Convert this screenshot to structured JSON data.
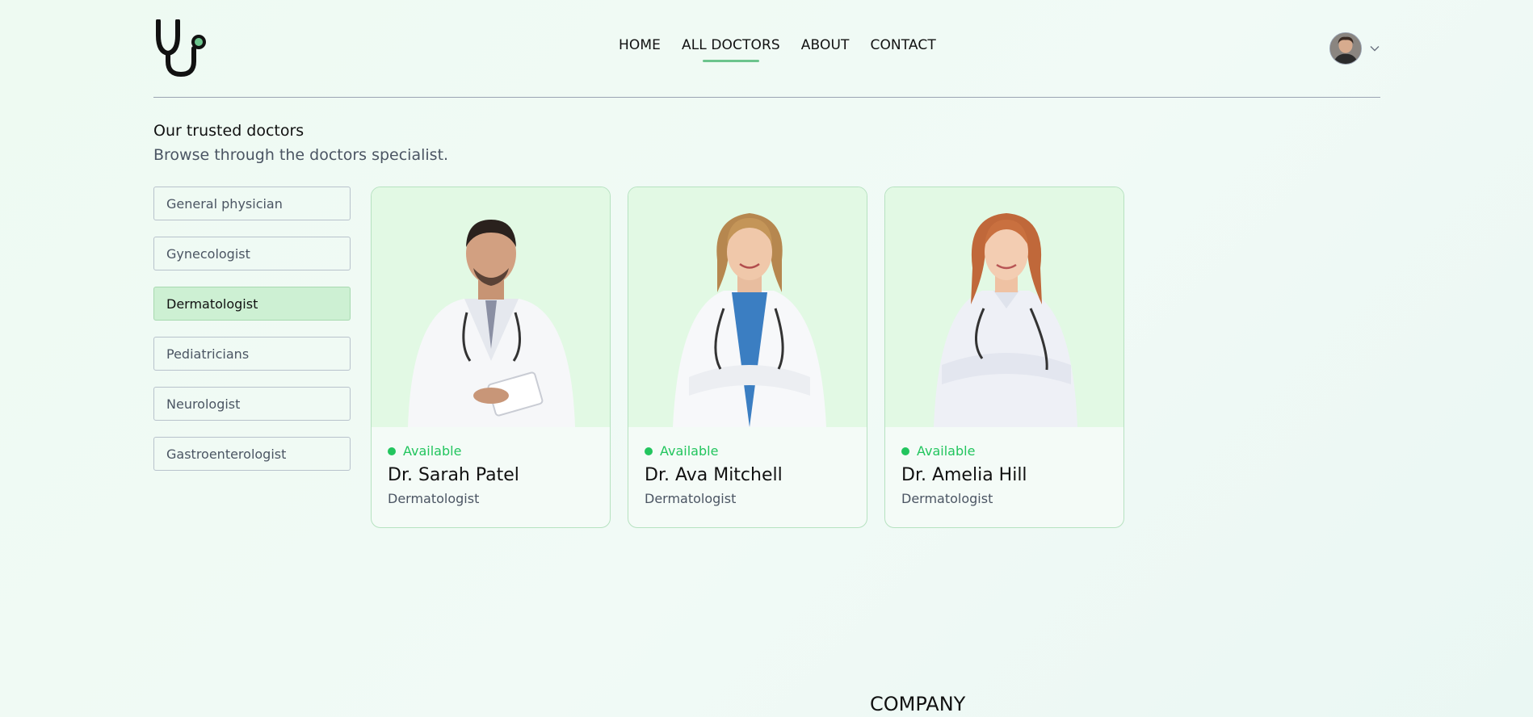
{
  "colors": {
    "accent": "#22c55e",
    "nav_underline": "#6cc48d",
    "selected_filter": "#cdf0d3",
    "card_image_bg": "#e2f9e4"
  },
  "header": {
    "logo_icon": "stethoscope-icon",
    "nav": [
      "HOME",
      "ALL DOCTORS",
      "ABOUT",
      "CONTACT"
    ],
    "active_nav": "ALL DOCTORS",
    "profile_menu_icon": "chevron-down-icon"
  },
  "intro": {
    "title": "Our trusted doctors",
    "subtitle": "Browse through the doctors specialist."
  },
  "filters": {
    "items": [
      "General physician",
      "Gynecologist",
      "Dermatologist",
      "Pediatricians",
      "Neurologist",
      "Gastroenterologist"
    ],
    "selected": "Dermatologist"
  },
  "doctors": [
    {
      "status": "Available",
      "name": "Dr. Sarah Patel",
      "speciality": "Dermatologist"
    },
    {
      "status": "Available",
      "name": "Dr. Ava Mitchell",
      "speciality": "Dermatologist"
    },
    {
      "status": "Available",
      "name": "Dr. Amelia Hill",
      "speciality": "Dermatologist"
    }
  ],
  "footer": {
    "company_heading": "COMPANY"
  }
}
